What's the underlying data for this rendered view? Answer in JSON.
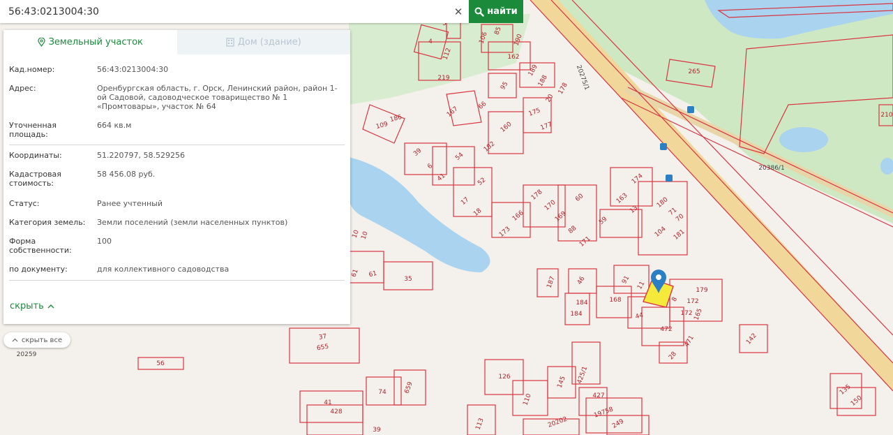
{
  "search": {
    "query": "56:43:0213004:30",
    "button_label": "найти"
  },
  "tabs": [
    {
      "label": "Земельный участок",
      "active": true
    },
    {
      "label": "Дом (здание)",
      "active": false
    }
  ],
  "details": {
    "cadastral_number": {
      "label": "Кад.номер:",
      "value": "56:43:0213004:30"
    },
    "address": {
      "label": "Адрес:",
      "value": "Оренбургская область, г. Орск, Ленинский район, район 1-ой Садовой, садоводческое товарищество № 1 «Промтовары», участок № 64"
    },
    "area": {
      "label": "Уточненная площадь:",
      "value": "664 кв.м"
    },
    "coordinates": {
      "label": "Координаты:",
      "value": "51.220797, 58.529256"
    },
    "cadastral_value": {
      "label": "Кадастровая стоимость:",
      "value": "58 456.08 руб."
    },
    "status": {
      "label": "Статус:",
      "value": "Ранее учтенный"
    },
    "land_category": {
      "label": "Категория земель:",
      "value": "Земли поселений (земли населенных пунктов)"
    },
    "ownership": {
      "label": "Форма собственности:",
      "value": "100"
    },
    "by_document": {
      "label": "по документу:",
      "value": "для коллективного садоводства"
    }
  },
  "panel": {
    "collapse_label": "скрыть"
  },
  "map": {
    "hide_all_label": "скрыть все",
    "colors": {
      "parcel_border": "#d93440",
      "forest": "#cfe8c4",
      "water": "#a9d3ee",
      "road": "#f1d79a",
      "selected": "#f5ea3c",
      "marker": "#2b7fc4"
    },
    "road_labels": [
      "20275/1",
      "20386/1",
      "20259"
    ],
    "parcel_labels": [
      "5",
      "4",
      "112",
      "219",
      "106",
      "85",
      "190",
      "162",
      "189",
      "95",
      "188",
      "178",
      "20",
      "175",
      "177",
      "167",
      "66",
      "186",
      "109",
      "160",
      "182",
      "39",
      "6",
      "54",
      "41",
      "52",
      "17",
      "18",
      "178",
      "170",
      "60",
      "169",
      "88",
      "171",
      "59",
      "166",
      "173",
      "163",
      "174",
      "13",
      "180",
      "71",
      "70",
      "104",
      "181",
      "265",
      "210",
      "10",
      "10",
      "61",
      "61",
      "35",
      "187",
      "46",
      "91",
      "11",
      "8",
      "179",
      "172",
      "168",
      "184",
      "184",
      "44",
      "172",
      "165",
      "472",
      "471",
      "28",
      "142",
      "37",
      "655",
      "56",
      "126",
      "145",
      "425/1",
      "427",
      "19758",
      "249",
      "659",
      "74",
      "110",
      "41",
      "428",
      "39",
      "113",
      "20202",
      "135",
      "150"
    ]
  }
}
